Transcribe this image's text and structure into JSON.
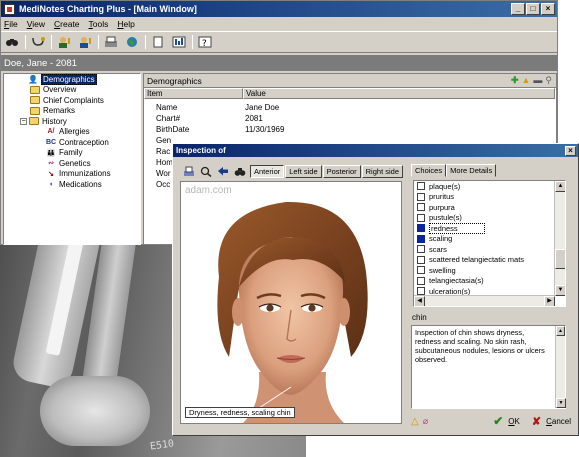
{
  "main_window": {
    "title": "MediNotes Charting Plus - [Main Window]",
    "menu": [
      "File",
      "View",
      "Create",
      "Tools",
      "Help"
    ],
    "patient": "Doe, Jane - 2081",
    "tree": [
      {
        "label": "Demographics",
        "icon": "person-icon",
        "selected": true
      },
      {
        "label": "Overview",
        "icon": "folder-icon"
      },
      {
        "label": "Chief Complaints",
        "icon": "folder-icon"
      },
      {
        "label": "Remarks",
        "icon": "folder-icon"
      },
      {
        "label": "History",
        "icon": "folder-icon",
        "expanded": true
      },
      {
        "label": "Allergies",
        "icon": "allergy-icon"
      },
      {
        "label": "Contraception",
        "icon": "contraception-icon"
      },
      {
        "label": "Family",
        "icon": "family-icon"
      },
      {
        "label": "Genetics",
        "icon": "genetics-icon"
      },
      {
        "label": "Immunizations",
        "icon": "syringe-icon"
      },
      {
        "label": "Medications",
        "icon": "pill-icon"
      }
    ],
    "pane_title": "Demographics",
    "grid_headers": [
      "Item",
      "Value"
    ],
    "grid_rows": [
      {
        "item": "Name",
        "value": "Jane Doe"
      },
      {
        "item": "Chart#",
        "value": "2081"
      },
      {
        "item": "BirthDate",
        "value": "11/30/1969"
      },
      {
        "item": "Gen",
        "value": ""
      },
      {
        "item": "Rac",
        "value": ""
      },
      {
        "item": "Hom",
        "value": ""
      },
      {
        "item": "Wor",
        "value": ""
      },
      {
        "item": "Occ",
        "value": ""
      }
    ]
  },
  "dialog": {
    "title": "Inspection of",
    "view_tabs": [
      "Anterior",
      "Left side",
      "Posterior",
      "Right side"
    ],
    "active_view": "Anterior",
    "watermark": "adam.com",
    "caption": "Dryness, redness, scaling chin",
    "choice_tabs": [
      "Choices",
      "More Details"
    ],
    "choices": [
      {
        "label": "plaque(s)",
        "checked": false
      },
      {
        "label": "pruritus",
        "checked": false
      },
      {
        "label": "purpura",
        "checked": false
      },
      {
        "label": "pustule(s)",
        "checked": false
      },
      {
        "label": "redness",
        "checked": true,
        "focus": true
      },
      {
        "label": "scaling",
        "checked": true
      },
      {
        "label": "scars",
        "checked": false
      },
      {
        "label": "scattered telangiectatic mats",
        "checked": false
      },
      {
        "label": "swelling",
        "checked": false
      },
      {
        "label": "telangiectasia(s)",
        "checked": false
      },
      {
        "label": "ulceration(s)",
        "checked": false
      }
    ],
    "region": "chin",
    "description": "Inspection of chin shows dryness, redness and scaling.  No skin rash, subcutaneous nodules, lesions or ulcers observed.",
    "ok_label": "OK",
    "cancel_label": "Cancel"
  },
  "xray": {
    "marker_text": "E510"
  }
}
